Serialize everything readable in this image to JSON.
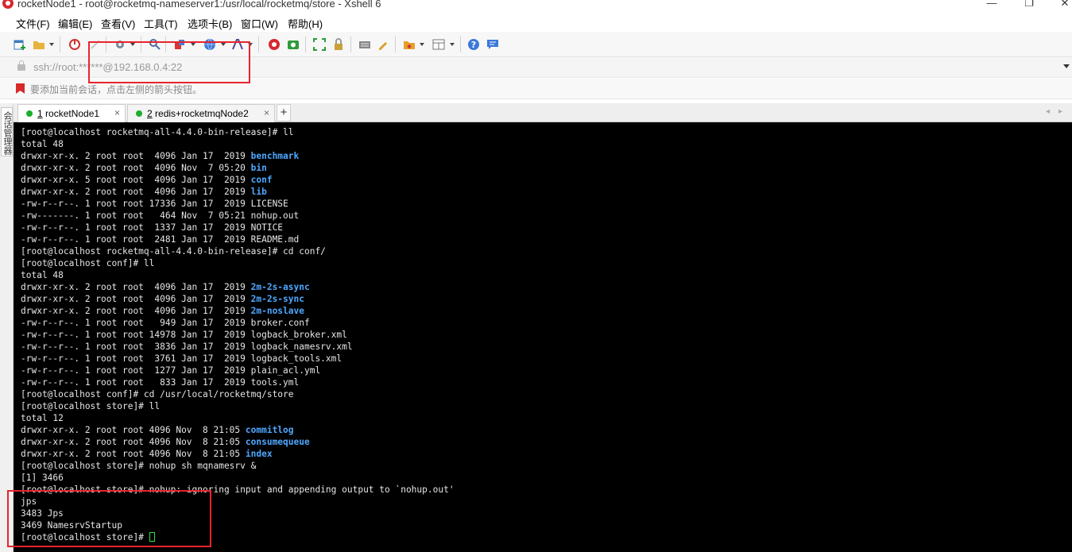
{
  "window": {
    "title": "rocketNode1 - root@rocketmq-nameserver1:/usr/local/rocketmq/store - Xshell 6",
    "minimize": "—",
    "maximize": "❐",
    "close": "✕"
  },
  "menu": [
    "文件(F)",
    "编辑(E)",
    "查看(V)",
    "工具(T)",
    "选项卡(B)",
    "窗口(W)",
    "帮助(H)"
  ],
  "address": {
    "value": "ssh://root:******@192.168.0.4:22"
  },
  "hint": {
    "text": "要添加当前会话，点击左侧的箭头按钮。"
  },
  "side_panel": {
    "label": "会话管理器"
  },
  "tabs": [
    {
      "number": "1",
      "label": " rocketNode1",
      "close": "×",
      "active": true
    },
    {
      "number": "2",
      "label": " redis+rocketmqNode2",
      "close": "×",
      "active": false
    }
  ],
  "tab_add": "+",
  "tab_nav": {
    "prev": "◂",
    "next": "▸"
  },
  "terminal": {
    "lines": [
      {
        "text": "[root@localhost rocketmq-all-4.4.0-bin-release]# ll"
      },
      {
        "text": "total 48"
      },
      {
        "text": "drwxr-xr-x. 2 root root  4096 Jan 17  2019 ",
        "dir": "benchmark"
      },
      {
        "text": "drwxr-xr-x. 2 root root  4096 Nov  7 05:20 ",
        "dir": "bin"
      },
      {
        "text": "drwxr-xr-x. 5 root root  4096 Jan 17  2019 ",
        "dir": "conf"
      },
      {
        "text": "drwxr-xr-x. 2 root root  4096 Jan 17  2019 ",
        "dir": "lib"
      },
      {
        "text": "-rw-r--r--. 1 root root 17336 Jan 17  2019 LICENSE"
      },
      {
        "text": "-rw-------. 1 root root   464 Nov  7 05:21 nohup.out"
      },
      {
        "text": "-rw-r--r--. 1 root root  1337 Jan 17  2019 NOTICE"
      },
      {
        "text": "-rw-r--r--. 1 root root  2481 Jan 17  2019 README.md"
      },
      {
        "text": "[root@localhost rocketmq-all-4.4.0-bin-release]# cd conf/"
      },
      {
        "text": "[root@localhost conf]# ll"
      },
      {
        "text": "total 48"
      },
      {
        "text": "drwxr-xr-x. 2 root root  4096 Jan 17  2019 ",
        "dir": "2m-2s-async"
      },
      {
        "text": "drwxr-xr-x. 2 root root  4096 Jan 17  2019 ",
        "dir": "2m-2s-sync"
      },
      {
        "text": "drwxr-xr-x. 2 root root  4096 Jan 17  2019 ",
        "dir": "2m-noslave"
      },
      {
        "text": "-rw-r--r--. 1 root root   949 Jan 17  2019 broker.conf"
      },
      {
        "text": "-rw-r--r--. 1 root root 14978 Jan 17  2019 logback_broker.xml"
      },
      {
        "text": "-rw-r--r--. 1 root root  3836 Jan 17  2019 logback_namesrv.xml"
      },
      {
        "text": "-rw-r--r--. 1 root root  3761 Jan 17  2019 logback_tools.xml"
      },
      {
        "text": "-rw-r--r--. 1 root root  1277 Jan 17  2019 plain_acl.yml"
      },
      {
        "text": "-rw-r--r--. 1 root root   833 Jan 17  2019 tools.yml"
      },
      {
        "text": "[root@localhost conf]# cd /usr/local/rocketmq/store"
      },
      {
        "text": "[root@localhost store]# ll"
      },
      {
        "text": "total 12"
      },
      {
        "text": "drwxr-xr-x. 2 root root 4096 Nov  8 21:05 ",
        "dir": "commitlog"
      },
      {
        "text": "drwxr-xr-x. 2 root root 4096 Nov  8 21:05 ",
        "dir": "consumequeue"
      },
      {
        "text": "drwxr-xr-x. 2 root root 4096 Nov  8 21:05 ",
        "dir": "index"
      },
      {
        "text": "[root@localhost store]# nohup sh mqnamesrv &"
      },
      {
        "text": "[1] 3466"
      },
      {
        "text": "[root@localhost store]# nohup: ignoring input and appending output to `nohup.out'"
      },
      {
        "text": "jps"
      },
      {
        "text": "3483 Jps"
      },
      {
        "text": "3469 NamesrvStartup"
      },
      {
        "text": "[root@localhost store]# ",
        "cursor": true
      }
    ]
  },
  "colors": {
    "terminal_bg": "#000000",
    "terminal_fg": "#e6e6e6",
    "directory": "#4ea8ff",
    "cursor": "#33dd44",
    "annotation_box": "#e8242d",
    "session_dot": "#1cae2d"
  }
}
